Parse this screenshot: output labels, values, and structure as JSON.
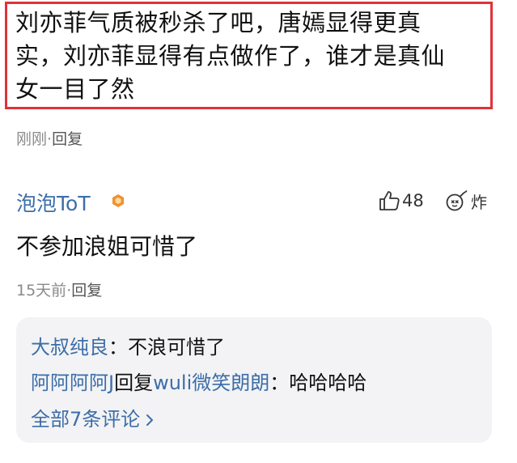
{
  "top_comment": {
    "lines": [
      "刘亦菲气质被秒杀了吧，唐嫣显得更真",
      "实，刘亦菲显得有点做作了，谁才是真仙",
      "女一目了然"
    ],
    "time": "刚刚",
    "dot": "·",
    "reply_label": "回复"
  },
  "comment": {
    "username": "泡泡ToT",
    "like_count": "48",
    "bomb_label": "炸",
    "text": "不参加浪姐可惜了",
    "time": "15天前",
    "dot": "·",
    "reply_label": "回复"
  },
  "replies": [
    {
      "user": "大叔纯良",
      "sep": "：",
      "text": "不浪可惜了"
    },
    {
      "user": "阿阿阿阿J",
      "mid": "回复",
      "target": "wuli微笑朗朗",
      "sep": "：",
      "text": "哈哈哈哈"
    }
  ],
  "all_replies_label": "全部7条评论",
  "colors": {
    "highlight_border": "#e0323a",
    "link_blue": "#3d6ea8",
    "badge_orange": "#f0932b",
    "reply_bg": "#f3f3f5"
  },
  "icons": [
    "thumbs-up-icon",
    "bomb-icon",
    "level-badge-icon",
    "chevron-right-icon"
  ]
}
